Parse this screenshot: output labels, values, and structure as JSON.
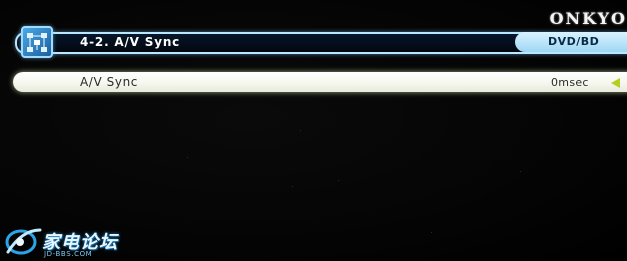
{
  "brand": {
    "name": "ONKYO"
  },
  "header": {
    "title": "4-2.  A/V Sync",
    "source": "DVD/BD",
    "icon_name": "speaker-grid-icon"
  },
  "settings": {
    "rows": [
      {
        "label": "A/V Sync",
        "value": "0msec",
        "arrow": "left-arrow-icon",
        "selected": true
      }
    ]
  },
  "watermark": {
    "title": "家电论坛",
    "subtitle": "JD-BBS.COM"
  },
  "colors": {
    "background": "#000000",
    "title_border": "#b8e7ff",
    "source_pill": "#bfe6fb",
    "selected_row": "#f6f7ee",
    "arrow": "#b5cf1e"
  }
}
